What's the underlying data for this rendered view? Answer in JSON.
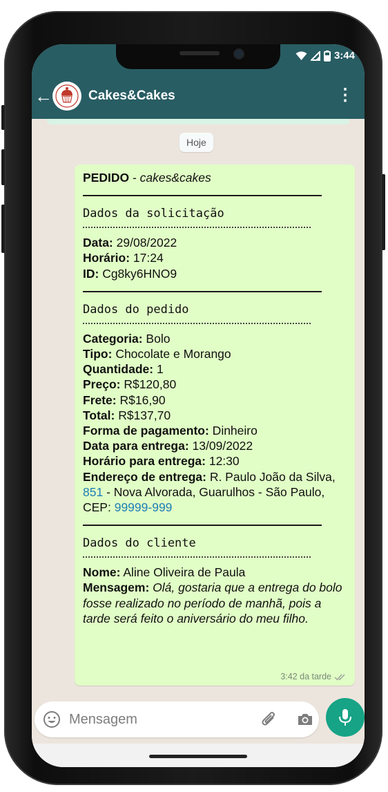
{
  "status": {
    "time": "3:44"
  },
  "header": {
    "title": "Cakes&Cakes"
  },
  "chat": {
    "date_label": "Hoje"
  },
  "message": {
    "line1_bold": "PEDIDO",
    "line1_rest": " - ",
    "line1_italic": "cakes&cakes",
    "section1": "Dados da solicitação",
    "data_label": "Data:",
    "data_value": " 29/08/2022",
    "horario_label": "Horário:",
    "horario_value": " 17:24",
    "id_label": "ID:",
    "id_value": " Cg8ky6HNO9",
    "section2": "Dados do pedido",
    "categoria_label": "Categoria:",
    "categoria_value": " Bolo",
    "tipo_label": "Tipo:",
    "tipo_value": " Chocolate e Morango",
    "quantidade_label": "Quantidade:",
    "quantidade_value": " 1",
    "preco_label": "Preço:",
    "preco_value": " R$120,80",
    "frete_label": "Frete:",
    "frete_value": " R$16,90",
    "total_label": "Total:",
    "total_value": " R$137,70",
    "pagamento_label": "Forma de pagamento:",
    "pagamento_value": " Dinheiro",
    "data_entrega_label": "Data para entrega:",
    "data_entrega_value": " 13/09/2022",
    "horario_entrega_label": "Horário para entrega:",
    "horario_entrega_value": " 12:30",
    "endereco_label": "Endereço de entrega:",
    "endereco_part1": " R. Paulo João da Silva, ",
    "endereco_number": "851",
    "endereco_part2": " - Nova Alvorada, Guarulhos - São Paulo, CEP: ",
    "endereco_cep": "99999-999",
    "section3": "Dados do cliente",
    "nome_label": "Nome:",
    "nome_value": " Aline Oliveira de Paula",
    "mensagem_label": "Mensagem:",
    "mensagem_value": " Olá, gostaria que a entrega do bolo fosse realizado no período de manhã, pois a tarde será feito o aniversário do meu filho.",
    "timestamp": "3:42 da tarde"
  },
  "input": {
    "placeholder": "Mensagem"
  },
  "colors": {
    "header": "#285d63",
    "bubble": "#e1fec6",
    "accent": "#16a386",
    "link": "#1d7fb6"
  },
  "icons": [
    "back-arrow-icon",
    "cupcake-logo-icon",
    "more-vert-icon",
    "wifi-icon",
    "signal-icon",
    "battery-icon",
    "double-check-icon",
    "emoji-icon",
    "paperclip-icon",
    "camera-icon",
    "mic-icon"
  ]
}
